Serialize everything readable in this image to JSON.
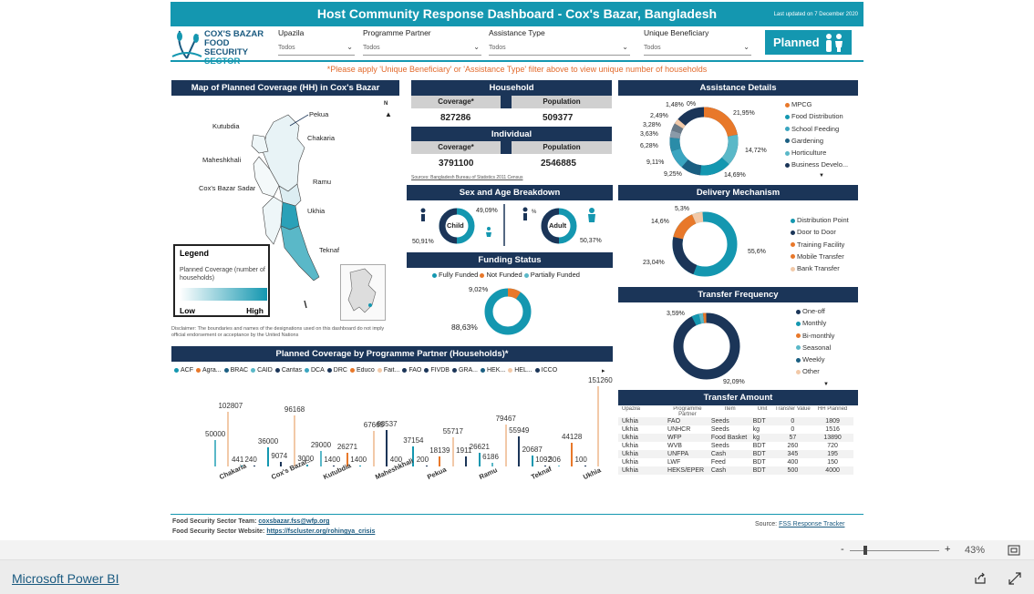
{
  "header": {
    "title": "Host Community Response Dashboard - Cox's Bazar, Bangladesh",
    "updated": "Last updated on 7 December 2020"
  },
  "logo": {
    "line1": "COX'S BAZAR",
    "line2": "FOOD SECURITY",
    "line3": "SECTOR"
  },
  "filters": [
    {
      "label": "Upazila",
      "value": "Todos"
    },
    {
      "label": "Programme Partner",
      "value": "Todos"
    },
    {
      "label": "Assistance Type",
      "value": "Todos"
    },
    {
      "label": "Unique Beneficiary",
      "value": "Todos"
    }
  ],
  "planned_label": "Planned",
  "warning": "*Please apply 'Unique Beneficiary' or 'Assistance Type' filter above to view unique number of households",
  "map": {
    "title": "Map of Planned Coverage (HH) in Cox's Bazar",
    "places": [
      "Kutubdia",
      "Pekua",
      "Chakaria",
      "Maheshkhali",
      "Cox's Bazar Sadar",
      "Ramu",
      "Ukhia",
      "Teknaf"
    ],
    "north": "N",
    "legend_title": "Legend",
    "legend_sub": "Planned Coverage (number of households)",
    "low": "Low",
    "high": "High",
    "disclaimer": "Disclaimer: The boundaries and names of the designations used on this dashboard do not imply official endorsement or acceptance by the United Nations"
  },
  "household": {
    "title": "Household",
    "coverage_label": "Coverage*",
    "population_label": "Population",
    "coverage": "827286",
    "population": "509377"
  },
  "individual": {
    "title": "Individual",
    "coverage_label": "Coverage*",
    "population_label": "Population",
    "coverage": "3791100",
    "population": "2546885"
  },
  "sources": "Sources: Bangladesh Bureau of Statistics 2011 Census",
  "sex_age": {
    "title": "Sex and Age Breakdown",
    "child_label": "Child",
    "adult_label": "Adult",
    "child_top": "49,09%",
    "child_bottom": "50,91%",
    "adult_top": "%",
    "adult_bottom": "50,37%"
  },
  "funding": {
    "title": "Funding Status",
    "legend": [
      "Fully Funded",
      "Not Funded",
      "Partially Funded"
    ],
    "legend_colors": [
      "#1497b0",
      "#e8782a",
      "#5ab8c8"
    ],
    "pct_small": "9,02%",
    "pct_big": "88,63%"
  },
  "assistance": {
    "title": "Assistance Details",
    "labels": [
      "1,48%",
      "0%",
      "2,49%",
      "3,28%",
      "3,63%",
      "6,28%",
      "9,11%",
      "9,25%",
      "14,69%",
      "14,72%",
      "21,95%"
    ],
    "legend": [
      "MPCG",
      "Food Distribution",
      "School Feeding",
      "Gardening",
      "Horticulture",
      "Business Develo..."
    ],
    "legend_colors": [
      "#e8782a",
      "#1497b0",
      "#3aa5c0",
      "#1b5f82",
      "#5ab8c8",
      "#1b3558"
    ]
  },
  "delivery": {
    "title": "Delivery Mechanism",
    "labels": [
      "5,3%",
      "14,6%",
      "23,04%",
      "55,6%"
    ],
    "legend": [
      "Distribution Point",
      "Door to Door",
      "Training Facility",
      "Mobile Transfer",
      "Bank Transfer"
    ],
    "legend_colors": [
      "#1497b0",
      "#1b3558",
      "#e8782a",
      "#e8782a",
      "#f2c9a8"
    ]
  },
  "frequency": {
    "title": "Transfer Frequency",
    "labels": [
      "3,59%",
      "92,09%"
    ],
    "legend": [
      "One-off",
      "Monthly",
      "Bi-monthly",
      "Seasonal",
      "Weekly",
      "Other"
    ],
    "legend_colors": [
      "#1b3558",
      "#1497b0",
      "#e8782a",
      "#5ab8c8",
      "#1b5f82",
      "#f2c9a8"
    ]
  },
  "transfer": {
    "title": "Transfer Amount",
    "columns": [
      "Upazila",
      "Programme Partner",
      "Item",
      "Unit",
      "Transfer Value",
      "HH Planned"
    ],
    "rows": [
      [
        "Ukhia",
        "FAO",
        "Seeds",
        "BDT",
        "0",
        "1809"
      ],
      [
        "Ukhia",
        "UNHCR",
        "Seeds",
        "kg",
        "0",
        "1516"
      ],
      [
        "Ukhia",
        "WFP",
        "Food Basket",
        "kg",
        "57",
        "13890"
      ],
      [
        "Ukhia",
        "WVB",
        "Seeds",
        "BDT",
        "260",
        "720"
      ],
      [
        "Ukhia",
        "UNFPA",
        "Cash",
        "BDT",
        "345",
        "195"
      ],
      [
        "Ukhia",
        "LWF",
        "Feed",
        "BDT",
        "400",
        "150"
      ],
      [
        "Ukhia",
        "HEKS/EPER",
        "Cash",
        "BDT",
        "500",
        "4000"
      ]
    ]
  },
  "partner_chart_title": "Planned Coverage by Programme Partner (Households)*",
  "chart_data": {
    "type": "bar",
    "legend": [
      "ACF",
      "Agra...",
      "BRAC",
      "CAID",
      "Caritas",
      "DCA",
      "DRC",
      "Educo",
      "Fait...",
      "FAO",
      "FIVDB",
      "GRA...",
      "HEK...",
      "HEL...",
      "ICCO"
    ],
    "legend_colors": [
      "#1497b0",
      "#e8782a",
      "#1b5f82",
      "#5ab8c8",
      "#1b3558",
      "#3aa5c0",
      "#1b3558",
      "#e8782a",
      "#f2c9a8",
      "#1b3558",
      "#1b3558",
      "#1b3558",
      "#1b5f82",
      "#f2c9a8",
      "#1b3558"
    ],
    "categories": [
      "Chakaria",
      "Cox's Bazar...",
      "Kutubdia",
      "Maheshkhali",
      "Pekua",
      "Ramu",
      "Teknaf",
      "Ukhia"
    ],
    "bars": [
      {
        "value": 50000,
        "label": "50000",
        "color": "#5ab8c8"
      },
      {
        "value": 102807,
        "label": "102807",
        "color": "#f2c9a8"
      },
      {
        "value": 441,
        "label": "441",
        "color": "#1497b0"
      },
      {
        "value": 240,
        "label": "240",
        "color": "#1b3558"
      },
      {
        "value": 36000,
        "label": "36000",
        "color": "#1497b0"
      },
      {
        "value": 9074,
        "label": "9074",
        "color": "#1b3558"
      },
      {
        "value": 96168,
        "label": "96168",
        "color": "#f2c9a8"
      },
      {
        "value": 3000,
        "label": "3000",
        "color": "#1497b0"
      },
      {
        "value": 29000,
        "label": "29000",
        "color": "#5ab8c8"
      },
      {
        "value": 1400,
        "label": "1400",
        "color": "#1b3558"
      },
      {
        "value": 26271,
        "label": "26271",
        "color": "#e8782a"
      },
      {
        "value": 1400,
        "label": "1400",
        "color": "#1497b0"
      },
      {
        "value": 67665,
        "label": "67665",
        "color": "#f2c9a8"
      },
      {
        "value": 68537,
        "label": "68537",
        "color": "#1b3558"
      },
      {
        "value": 400,
        "label": "400",
        "color": "#5ab8c8"
      },
      {
        "value": 37154,
        "label": "37154",
        "color": "#1497b0"
      },
      {
        "value": 200,
        "label": "200",
        "color": "#1b3558"
      },
      {
        "value": 18139,
        "label": "18139",
        "color": "#e8782a"
      },
      {
        "value": 55717,
        "label": "55717",
        "color": "#f2c9a8"
      },
      {
        "value": 19110,
        "label": "1911",
        "color": "#1b3558"
      },
      {
        "value": 26621,
        "label": "26621",
        "color": "#1497b0"
      },
      {
        "value": 6186,
        "label": "6186",
        "color": "#5ab8c8"
      },
      {
        "value": 79467,
        "label": "79467",
        "color": "#f2c9a8"
      },
      {
        "value": 55949,
        "label": "55949",
        "color": "#1b3558"
      },
      {
        "value": 20687,
        "label": "20687",
        "color": "#1497b0"
      },
      {
        "value": 1092,
        "label": "1092",
        "color": "#1b3558"
      },
      {
        "value": 306,
        "label": "306",
        "color": "#5ab8c8"
      },
      {
        "value": 44128,
        "label": "44128",
        "color": "#e8782a"
      },
      {
        "value": 100,
        "label": "100",
        "color": "#1b3558"
      },
      {
        "value": 151260,
        "label": "151260",
        "color": "#f2c9a8"
      }
    ],
    "ylim": [
      0,
      151260
    ]
  },
  "footer": {
    "team_label": "Food Security Sector Team:",
    "team_email": "coxsbazar.fss@wfp.org",
    "web_label": "Food Security Sector Website:",
    "web_url": "https://fscluster.org/rohingya_crisis",
    "source_label": "Source:",
    "source_link": "FSS Response Tracker"
  },
  "zoom": {
    "minus": "-",
    "plus": "+",
    "value": "43%"
  },
  "app": {
    "name": "Microsoft Power BI"
  }
}
